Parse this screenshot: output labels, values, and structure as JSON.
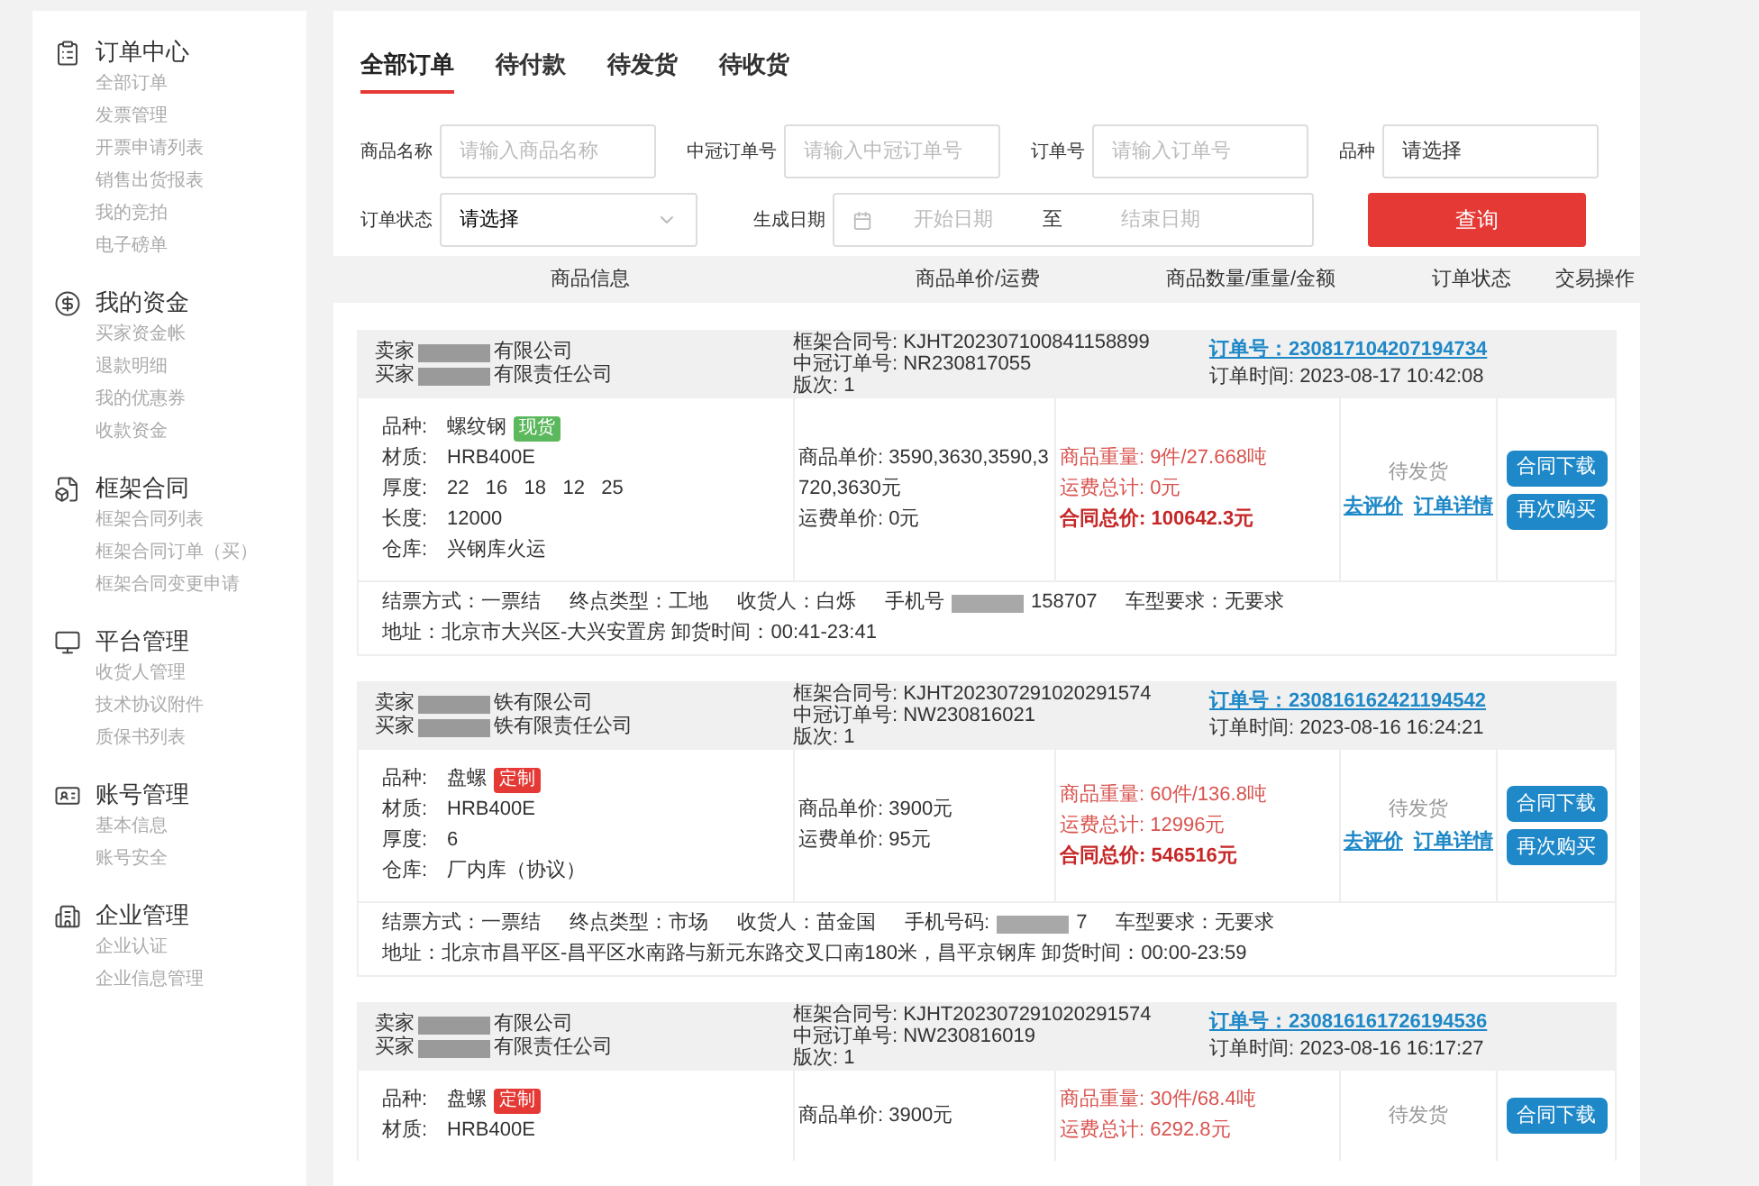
{
  "sidebar": [
    {
      "title": "订单中心",
      "items": [
        "全部订单",
        "发票管理",
        "开票申请列表",
        "销售出货报表",
        "我的竞拍",
        "电子磅单"
      ]
    },
    {
      "title": "我的资金",
      "items": [
        "买家资金帐",
        "退款明细",
        "我的优惠券",
        "收款资金"
      ]
    },
    {
      "title": "框架合同",
      "items": [
        "框架合同列表",
        "框架合同订单（买）",
        "框架合同变更申请"
      ]
    },
    {
      "title": "平台管理",
      "items": [
        "收货人管理",
        "技术协议附件",
        "质保书列表"
      ]
    },
    {
      "title": "账号管理",
      "items": [
        "基本信息",
        "账号安全"
      ]
    },
    {
      "title": "企业管理",
      "items": [
        "企业认证",
        "企业信息管理"
      ]
    }
  ],
  "tabs": [
    {
      "label": "全部订单",
      "selected": true
    },
    {
      "label": "待付款",
      "selected": false
    },
    {
      "label": "待发货",
      "selected": false
    },
    {
      "label": "待收货",
      "selected": false
    }
  ],
  "filters": {
    "row1": [
      {
        "label": "商品名称",
        "placeholder": "请输入商品名称",
        "kind": "input"
      },
      {
        "label": "中冠订单号",
        "placeholder": "请输入中冠订单号",
        "kind": "input"
      },
      {
        "label": "订单号",
        "placeholder": "请输入订单号",
        "kind": "input"
      },
      {
        "label": "品种",
        "value": "请选择",
        "kind": "select"
      }
    ],
    "status": {
      "label": "订单状态",
      "value": "请选择"
    },
    "date": {
      "label": "生成日期",
      "start_placeholder": "开始日期",
      "separator": "至",
      "end_placeholder": "结束日期"
    },
    "query_button": "查询"
  },
  "table": {
    "columns": [
      "商品信息",
      "商品单价/运费",
      "商品数量/重量/金额",
      "订单状态",
      "交易操作"
    ]
  },
  "orders": [
    {
      "seller_label": "卖家",
      "seller": "有限公司",
      "buyer_label": "买家",
      "buyer": "有限责任公司",
      "contract": "框架合同号: KJHT202307100841158899",
      "zg_order": "中冠订单号: NR230817055",
      "version": "版次: 1",
      "order_no": "订单号：230817104207194734",
      "order_time": "订单时间: 2023-08-17 10:42:08",
      "specs": [
        {
          "label": "品种:",
          "value": "螺纹钢",
          "tag": {
            "text": "现货",
            "kind": "spot"
          }
        },
        {
          "label": "材质:",
          "value": "HRB400E"
        },
        {
          "label": "厚度:",
          "value": "22   16   18   12   25"
        },
        {
          "label": "长度:",
          "value": "12000"
        },
        {
          "label": "仓库:",
          "value": "兴钢库火运"
        }
      ],
      "prices": [
        "商品单价: 3590,3630,3590,3720,3630元",
        "运费单价: 0元"
      ],
      "amounts": [
        {
          "text": "商品重量: 9件/27.668吨",
          "bold": false
        },
        {
          "text": "运费总计: 0元",
          "bold": false
        },
        {
          "text": "合同总价: 100642.3元",
          "bold": true
        }
      ],
      "status": "待发货",
      "links": [
        "去评价",
        "订单详情"
      ],
      "buttons": [
        "合同下载",
        "再次购买"
      ],
      "footer": [
        {
          "kind": "text",
          "text": "结票方式：一票结"
        },
        {
          "kind": "text",
          "text": "终点类型：工地"
        },
        {
          "kind": "text",
          "text": "收货人：白烁"
        },
        {
          "kind": "masked",
          "label": "手机号",
          "value": "158707"
        },
        {
          "kind": "text",
          "text": "车型要求：无要求"
        }
      ],
      "address": "地址：北京市大兴区-大兴安置房 卸货时间：00:41-23:41"
    },
    {
      "seller_label": "卖家",
      "seller": "铁有限公司",
      "buyer_label": "买家",
      "buyer": "铁有限责任公司",
      "contract": "框架合同号: KJHT202307291020291574",
      "zg_order": "中冠订单号: NW230816021",
      "version": "版次: 1",
      "order_no": "订单号：230816162421194542",
      "order_time": "订单时间: 2023-08-16 16:24:21",
      "specs": [
        {
          "label": "品种:",
          "value": "盘螺",
          "tag": {
            "text": "定制",
            "kind": "custom"
          }
        },
        {
          "label": "材质:",
          "value": "HRB400E"
        },
        {
          "label": "厚度:",
          "value": "6"
        },
        {
          "label": "仓库:",
          "value": "厂内库（协议）"
        }
      ],
      "prices": [
        "商品单价: 3900元",
        "运费单价: 95元"
      ],
      "amounts": [
        {
          "text": "商品重量: 60件/136.8吨",
          "bold": false
        },
        {
          "text": "运费总计: 12996元",
          "bold": false
        },
        {
          "text": "合同总价: 546516元",
          "bold": true
        }
      ],
      "status": "待发货",
      "links": [
        "去评价",
        "订单详情"
      ],
      "buttons": [
        "合同下载",
        "再次购买"
      ],
      "footer": [
        {
          "kind": "text",
          "text": "结票方式：一票结"
        },
        {
          "kind": "text",
          "text": "终点类型：市场"
        },
        {
          "kind": "text",
          "text": "收货人：苗金国"
        },
        {
          "kind": "masked",
          "label": "手机号码:",
          "value": "7"
        },
        {
          "kind": "text",
          "text": "车型要求：无要求"
        }
      ],
      "address": "地址：北京市昌平区-昌平区水南路与新元东路交叉口南180米，昌平京钢库 卸货时间：00:00-23:59"
    },
    {
      "seller_label": "卖家",
      "seller": "有限公司",
      "buyer_label": "买家",
      "buyer": "有限责任公司",
      "contract": "框架合同号: KJHT202307291020291574",
      "zg_order": "中冠订单号: NW230816019",
      "version": "版次: 1",
      "order_no": "订单号：230816161726194536",
      "order_time": "订单时间: 2023-08-16 16:17:27",
      "specs": [
        {
          "label": "品种:",
          "value": "盘螺",
          "tag": {
            "text": "定制",
            "kind": "custom"
          }
        },
        {
          "label": "材质:",
          "value": "HRB400E"
        }
      ],
      "prices": [
        "商品单价: 3900元"
      ],
      "amounts": [
        {
          "text": "商品重量: 30件/68.4吨",
          "bold": false
        },
        {
          "text": "运费总计: 6292.8元",
          "bold": false
        }
      ],
      "status": "待发货",
      "buttons": [
        "合同下载"
      ]
    }
  ]
}
